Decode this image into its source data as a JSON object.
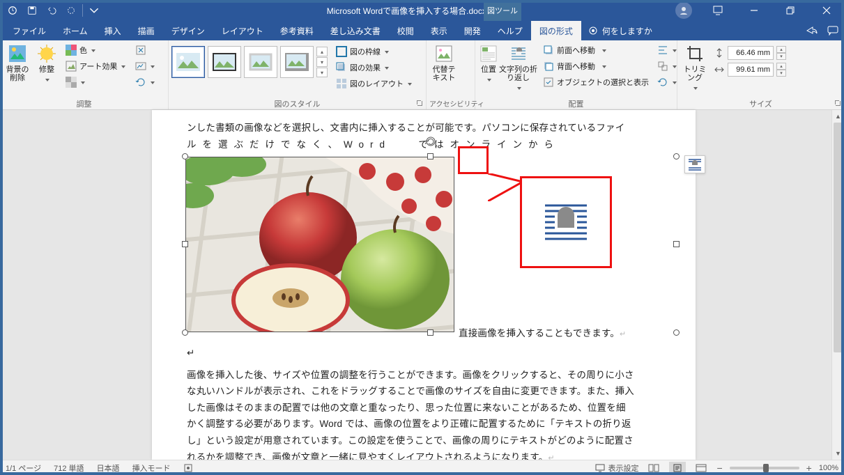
{
  "qat": {
    "autosave": "autosave",
    "save": "save",
    "undo": "undo",
    "redo": "redo"
  },
  "title": {
    "filename": "Microsoft Wordで画像を挿入する場合.docx",
    "app": "Word",
    "context_tab": "図ツール"
  },
  "window_controls": {
    "ribbon_opts": "ribbon-options",
    "min": "minimize",
    "restore": "restore",
    "close": "close"
  },
  "tabs": {
    "items": [
      "ファイル",
      "ホーム",
      "挿入",
      "描画",
      "デザイン",
      "レイアウト",
      "参考資料",
      "差し込み文書",
      "校閲",
      "表示",
      "開発",
      "ヘルプ",
      "図の形式"
    ],
    "selected": "図の形式",
    "tellme": "何をしますか"
  },
  "ribbon": {
    "adjust": {
      "label": "調整",
      "remove_bg": "背景の\n削除",
      "corrections": "修整",
      "color": "色",
      "artistic": "アート効果",
      "transparency": "透",
      "compress": "圧",
      "change": "変",
      "reset": "リ"
    },
    "styles": {
      "label": "図のスタイル",
      "border": "図の枠線",
      "effects": "図の効果",
      "layout": "図のレイアウト"
    },
    "accessibility": {
      "label": "アクセシビリティ",
      "alt_text": "代替テ\nキスト"
    },
    "arrange": {
      "label": "配置",
      "position": "位置",
      "wrap": "文字列の折\nり返し",
      "bring": "前面へ移動",
      "send": "背面へ移動",
      "selpane": "オブジェクトの選択と表示",
      "align": "align",
      "group": "group",
      "rotate": "rotate"
    },
    "size": {
      "label": "サイズ",
      "crop": "トリミング",
      "height": "66.46 mm",
      "width": "99.61 mm"
    }
  },
  "document": {
    "line1": "ンした書類の画像などを選択し、文書内に挿入することが可能です。パソコンに保存されているファイ",
    "line2_a": "ルを選ぶだけ",
    "line2_b": "でなく、Word",
    "line2_c": "ではオンラインから",
    "aside": "直接画像を挿入することもできます。",
    "para1": "画像を挿入した後、サイズや位置の調整を行うことができます。画像をクリックすると、その周りに小さ",
    "para2": "な丸いハンドルが表示され、これをドラッグすることで画像のサイズを自由に変更できます。また、挿入",
    "para3": "した画像はそのままの配置では他の文章と重なったり、思った位置に来ないことがあるため、位置を細",
    "para4": "かく調整する必要があります。Word では、画像の位置をより正確に配置するために「テキストの折り返",
    "para5": "し」という設定が用意されています。この設定を使うことで、画像の周りにテキストがどのように配置さ",
    "para6": "れるかを調整でき、画像が文章と一緒に見やすくレイアウトされるようになります。"
  },
  "status": {
    "page": "1/1 ページ",
    "words": "712 単語",
    "lang": "日本語",
    "mode": "挿入モード",
    "macro": "macros",
    "focus": "表示設定",
    "zoom": "100%"
  }
}
